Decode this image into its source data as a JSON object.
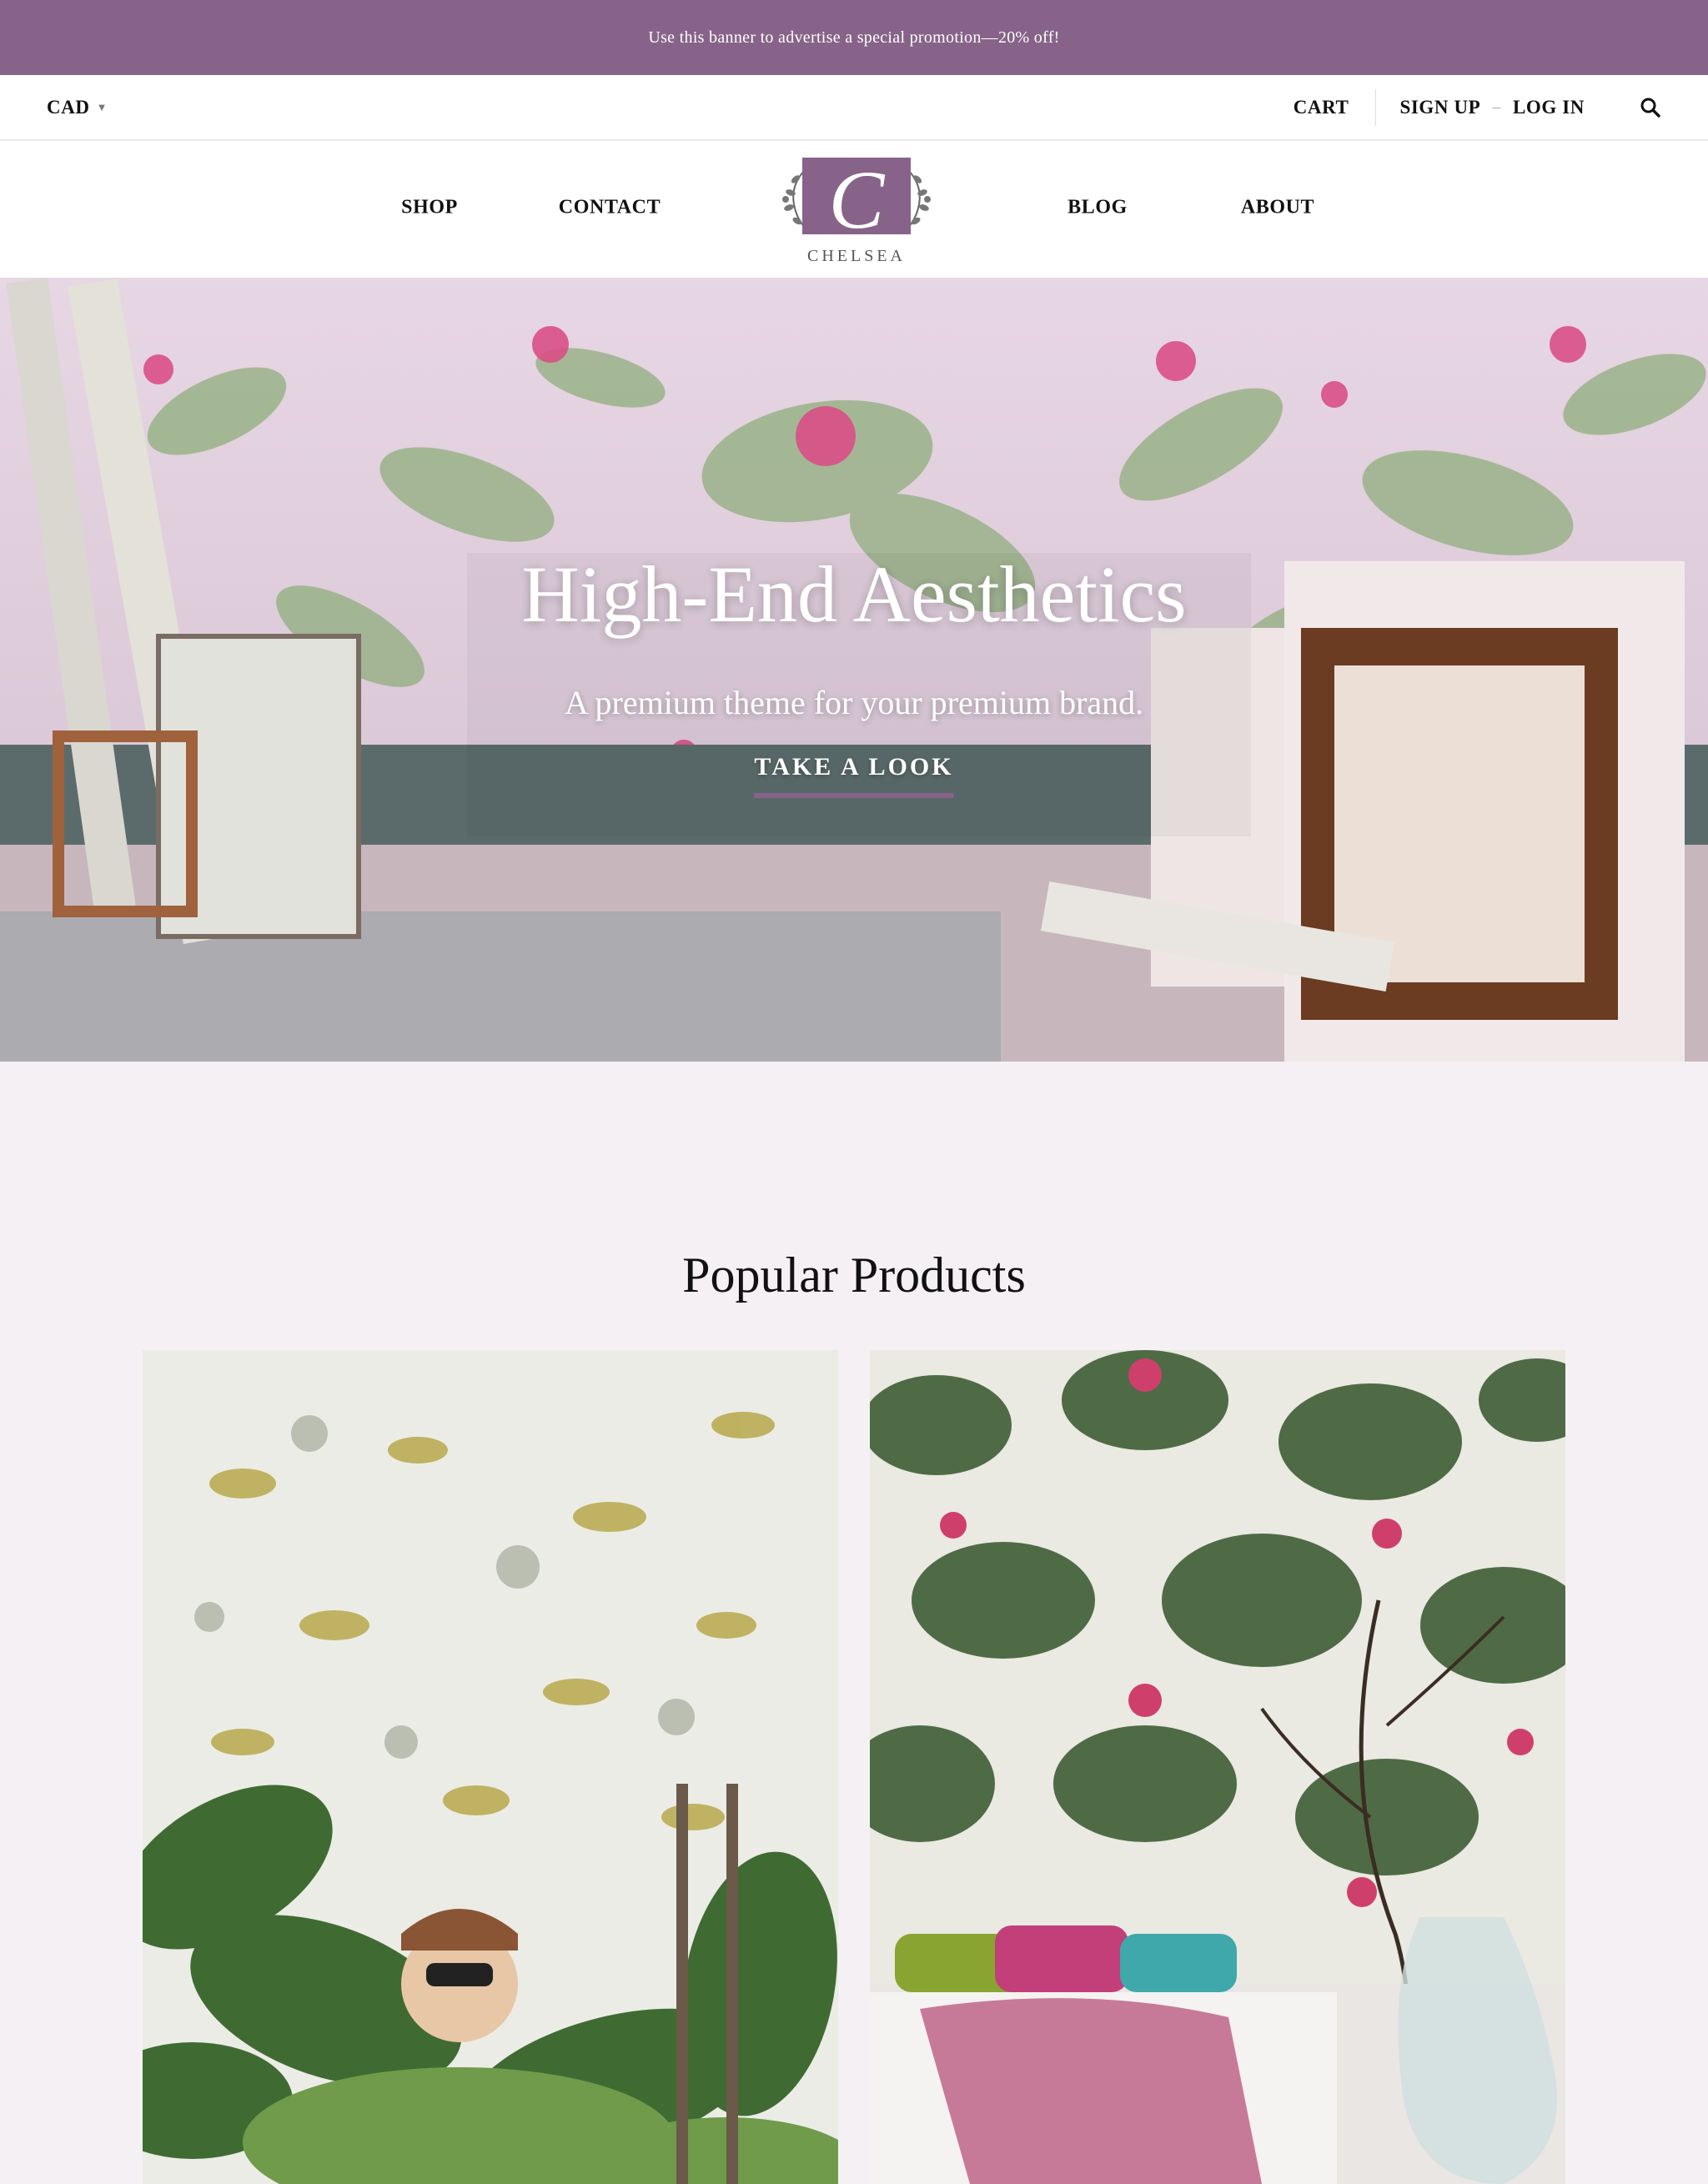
{
  "promo_banner": {
    "text": "Use this banner to advertise a special promotion—20% off!"
  },
  "utility_bar": {
    "currency": "CAD",
    "currency_caret_icon": "caret-down-icon",
    "cart": "CART",
    "sign_up": "SIGN UP",
    "separator": "–",
    "log_in": "LOG IN",
    "search_icon": "search-icon"
  },
  "main_nav": {
    "left": [
      "SHOP",
      "CONTACT"
    ],
    "right": [
      "BLOG",
      "ABOUT"
    ],
    "logo": {
      "monogram": "C",
      "name": "CHELSEA"
    }
  },
  "hero": {
    "title": "High-End Aesthetics",
    "subtitle": "A premium theme for your premium brand.",
    "cta": "TAKE A LOOK"
  },
  "popular_products": {
    "heading": "Popular Products",
    "items": [
      {
        "image": "dinosaur-wallpaper-with-plants-and-child"
      },
      {
        "image": "tropical-floral-wallpaper-bedroom"
      }
    ]
  },
  "colors": {
    "brand_purple": "#876389",
    "page_background": "#f5f0f4",
    "text": "#111111"
  }
}
